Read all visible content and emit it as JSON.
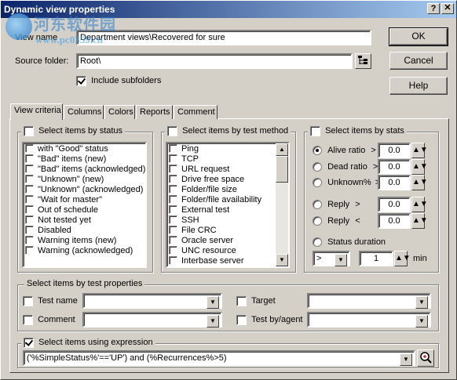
{
  "window": {
    "title": "Dynamic view properties",
    "help_glyph": "?",
    "close_glyph": "✕"
  },
  "watermark": {
    "text": "河东软件园",
    "url": "www.pc0359.cn"
  },
  "header": {
    "view_name_label": "View name",
    "view_name_value": "Department views\\Recovered for sure",
    "source_folder_label": "Source folder:",
    "source_folder_value": "Root\\",
    "include_subfolders_label": "Include subfolders",
    "include_subfolders_checked": true
  },
  "buttons": {
    "ok": "OK",
    "cancel": "Cancel",
    "help": "Help"
  },
  "tabs": [
    {
      "label": "View criteria",
      "active": true
    },
    {
      "label": "Columns",
      "active": false
    },
    {
      "label": "Colors",
      "active": false
    },
    {
      "label": "Reports",
      "active": false
    },
    {
      "label": "Comment",
      "active": false
    }
  ],
  "status_group": {
    "title": "Select items by status",
    "items": [
      "with \"Good\" status",
      "\"Bad\" items (new)",
      "\"Bad\" items (acknowledged)",
      "\"Unknown\" (new)",
      "\"Unknown\" (acknowledged)",
      "\"Wait for master\"",
      "Out of schedule",
      "Not tested yet",
      "Disabled",
      "Warning items (new)",
      "Warning (acknowledged)"
    ]
  },
  "method_group": {
    "title": "Select items by test method",
    "items": [
      "Ping",
      "TCP",
      "URL request",
      "Drive free space",
      "Folder/file size",
      "Folder/file availability",
      "External test",
      "SSH",
      "File CRC",
      "Oracle server",
      "UNC resource",
      "Interbase server"
    ]
  },
  "stats_group": {
    "title": "Select items by stats",
    "rows": [
      {
        "label": "Alive ratio",
        "op": ">",
        "value": "0.0",
        "checked": true
      },
      {
        "label": "Dead ratio",
        "op": ">",
        "value": "0.0",
        "checked": false
      },
      {
        "label": "Unknown%",
        "op": ">",
        "value": "0.0",
        "checked": false
      },
      {
        "label": "Reply",
        "op": ">",
        "value": "0.0",
        "checked": false
      },
      {
        "label": "Reply",
        "op": "<",
        "value": "0.0",
        "checked": false
      }
    ],
    "duration_label": "Status duration",
    "duration_op": ">",
    "duration_value": "1",
    "duration_unit": "min"
  },
  "properties_group": {
    "title": "Select items by test properties",
    "test_name_label": "Test name",
    "comment_label": "Comment",
    "target_label": "Target",
    "test_by_agent_label": "Test by/agent"
  },
  "expression_group": {
    "title": "Select items using expression",
    "checked": true,
    "value": "('%SimpleStatus%'=='UP') and (%Recurrences%>5)"
  }
}
